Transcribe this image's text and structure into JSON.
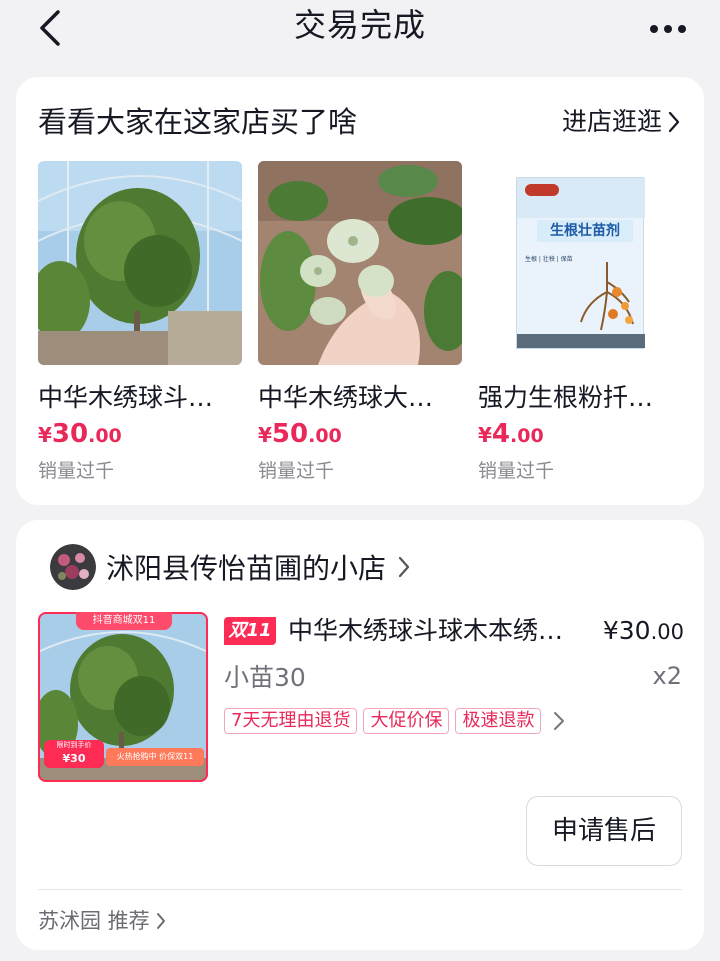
{
  "header": {
    "title": "交易完成",
    "back_icon": "chevron-left-icon",
    "more_icon": "ellipsis-icon"
  },
  "recommend": {
    "title": "看看大家在这家店买了啥",
    "visit_store": "进店逛逛",
    "products": [
      {
        "name": "中华木绣球斗…",
        "price_symbol": "¥",
        "price_int": "30",
        "price_dec": ".00",
        "sales": "销量过千",
        "image": "tree-in-greenhouse"
      },
      {
        "name": "中华木绣球大…",
        "price_symbol": "¥",
        "price_int": "50",
        "price_dec": ".00",
        "sales": "销量过千",
        "image": "flower-bud-in-hand"
      },
      {
        "name": "强力生根粉扦…",
        "price_symbol": "¥",
        "price_int": "4",
        "price_dec": ".00",
        "sales": "销量过千",
        "image": "rooting-powder-packet"
      }
    ],
    "packet_text": {
      "brand_line": "",
      "title": "生根壮苗剂",
      "sub": "生根 | 壮秧 | 保苗"
    }
  },
  "order": {
    "shop_name": "沭阳县传怡苗圃的小店",
    "thumb_banner": "抖音商城双11",
    "thumb_badge_top": "限时到手价",
    "thumb_badge_price": "¥30",
    "thumb_badge_right": "火热抢购中 价保双11",
    "promo_tag": "双11",
    "product_name": "中华木绣球斗球木本绣…",
    "price_int": "¥30",
    "price_dec": ".00",
    "spec": "小苗30",
    "quantity": "x2",
    "services": [
      "7天无理由退货",
      "大促价保",
      "极速退款"
    ],
    "after_sales_button": "申请售后",
    "recommend_text": "苏沭园 推荐"
  },
  "colors": {
    "accent": "#fe2c55",
    "price": "#e8295a",
    "background": "#f2f2f4"
  }
}
